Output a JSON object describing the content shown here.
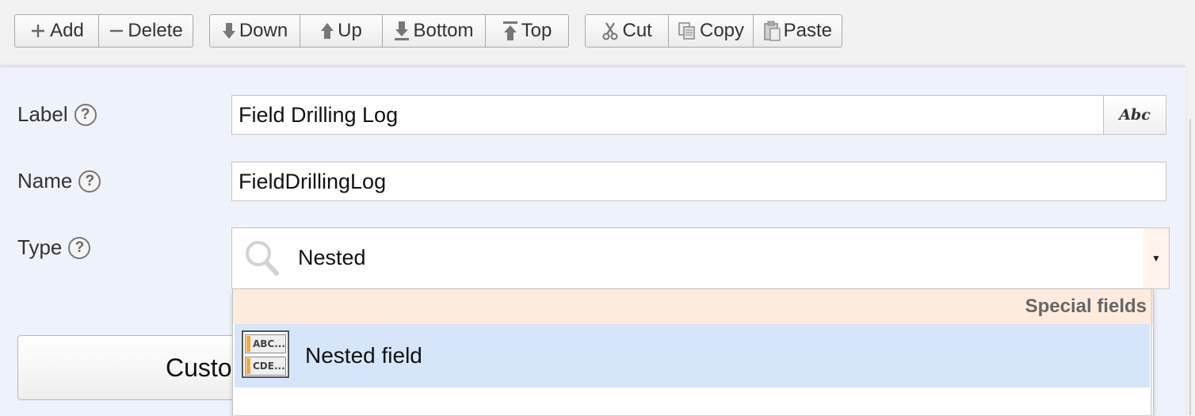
{
  "toolbar": {
    "add": "Add",
    "delete": "Delete",
    "down": "Down",
    "up": "Up",
    "bottom": "Bottom",
    "top": "Top",
    "cut": "Cut",
    "copy": "Copy",
    "paste": "Paste"
  },
  "form": {
    "label": {
      "caption": "Label",
      "help": "?",
      "value": "Field Drilling Log",
      "format_button": "Abc"
    },
    "name": {
      "caption": "Name",
      "help": "?",
      "value": "FieldDrillingLog"
    },
    "type": {
      "caption": "Type",
      "help": "?",
      "value": "Nested"
    }
  },
  "dropdown": {
    "group_header": "Special fields",
    "options": [
      {
        "label": "Nested field",
        "icon": "nested-field-icon",
        "icon_rows": [
          "ABC...",
          "CDE..."
        ]
      }
    ]
  },
  "custom_button": "Custo",
  "colors": {
    "panel_bg": "#eef2fb",
    "group_header_bg": "#fdebdd",
    "option_highlight": "#d7e5fa"
  }
}
